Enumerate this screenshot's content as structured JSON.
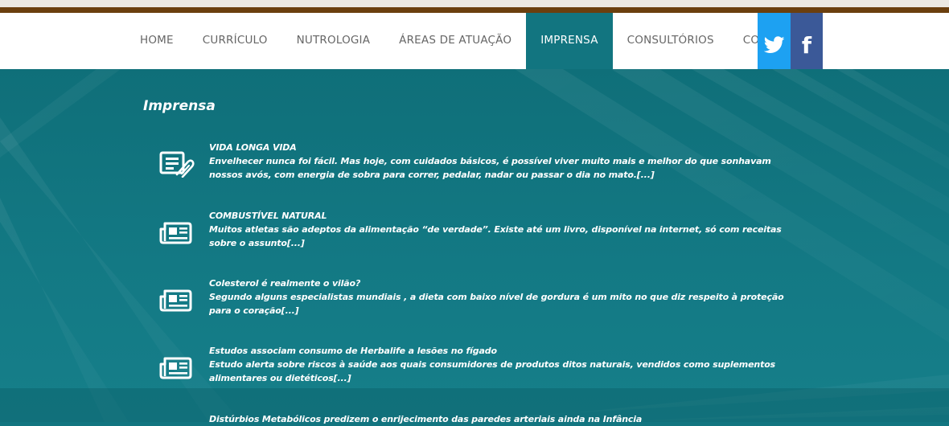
{
  "nav": {
    "items": [
      {
        "label": "HOME",
        "active": false
      },
      {
        "label": "CURRÍCULO",
        "active": false
      },
      {
        "label": "NUTROLOGIA",
        "active": false
      },
      {
        "label": "ÁREAS DE ATUAÇÃO",
        "active": false
      },
      {
        "label": "IMPRENSA",
        "active": true
      },
      {
        "label": "CONSULTÓRIOS",
        "active": false
      },
      {
        "label": "CONTATO",
        "active": false
      }
    ]
  },
  "social": {
    "twitter_icon": "twitter-icon",
    "facebook_icon": "facebook-icon",
    "facebook_glyph": "f",
    "twitter_color": "#1da1f2",
    "facebook_color": "#3b5998"
  },
  "page": {
    "title": "Imprensa",
    "background_color": "#127580"
  },
  "articles": [
    {
      "icon": "document-edit-icon",
      "title": "VIDA LONGA VIDA",
      "excerpt": "Envelhecer nunca foi fácil. Mas hoje, com cuidados básicos, é possível viver muito mais e melhor do que sonhavam nossos avós, com energia de sobra para correr, pedalar, nadar ou passar o dia no mato.[...]"
    },
    {
      "icon": "newspaper-icon",
      "title": "COMBUSTÍVEL NATURAL",
      "excerpt": "Muitos atletas são adeptos da alimentação “de verdade”. Existe até um livro, disponível na internet, só com receitas sobre o assunto[...]"
    },
    {
      "icon": "newspaper-icon",
      "title": "Colesterol é realmente o vilão?",
      "excerpt": "Segundo alguns especialistas mundiais , a dieta com baixo nível de gordura é um mito no que diz respeito à proteção para o coração[...]"
    },
    {
      "icon": "newspaper-icon",
      "title": "Estudos associam consumo de Herbalife a lesões no fígado",
      "excerpt": "Estudo alerta sobre riscos à saúde aos quais consumidores de produtos ditos naturais, vendidos como suplementos alimentares ou dietéticos[...]"
    },
    {
      "icon": "newspaper-icon",
      "title": "Distúrbios Metabólicos predizem o enrijecimento das paredes arteriais ainda na Infância",
      "excerpt": ""
    }
  ]
}
